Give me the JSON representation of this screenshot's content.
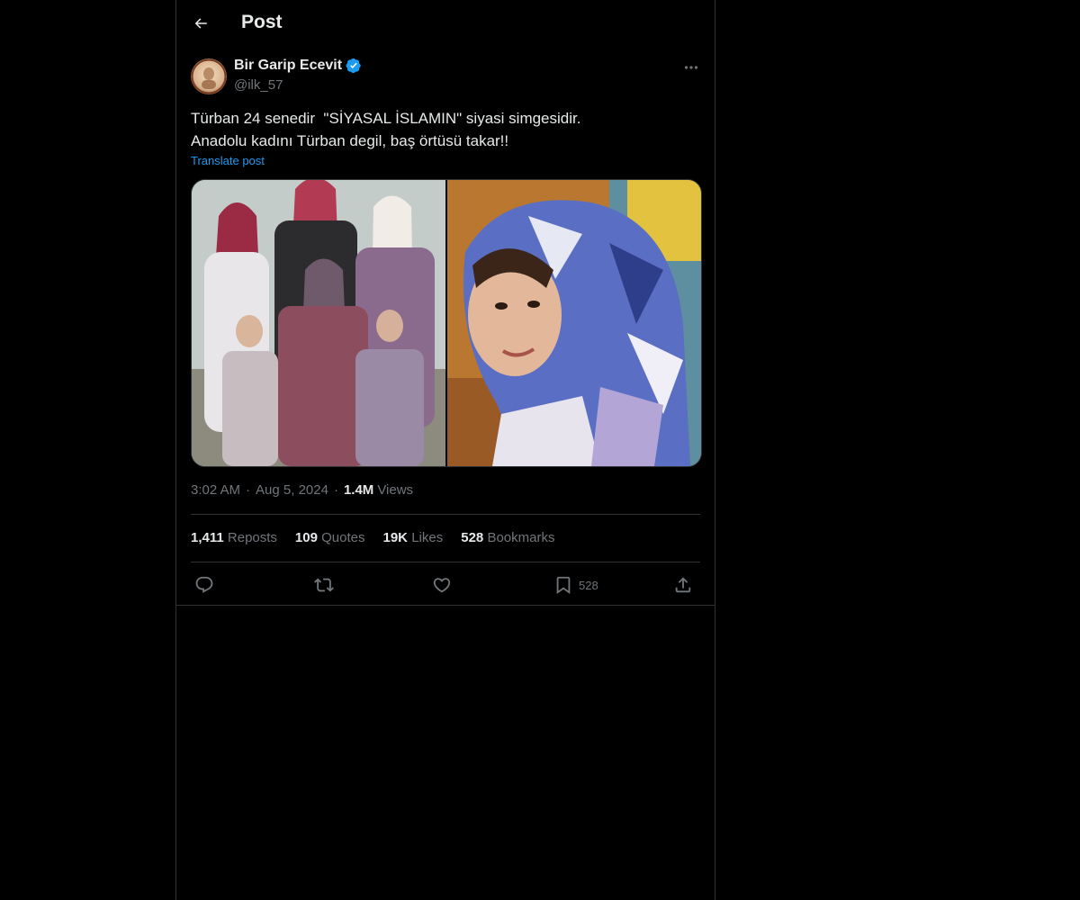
{
  "header": {
    "title": "Post"
  },
  "author": {
    "name": "Bir Garip Ecevit",
    "handle": "@ilk_57",
    "verified": true
  },
  "post": {
    "lines": [
      "Türban 24 senedir  \"SİYASAL İSLAMIN\" siyasi simgesidir.",
      "Anadolu kadını Türban degil, baş örtüsü takar!!"
    ],
    "translate_label": "Translate post"
  },
  "meta": {
    "time": "3:02 AM",
    "separator": "·",
    "date": "Aug 5, 2024",
    "views_count": "1.4M",
    "views_label": "Views"
  },
  "stats": {
    "reposts": {
      "count": "1,411",
      "label": "Reposts"
    },
    "quotes": {
      "count": "109",
      "label": "Quotes"
    },
    "likes": {
      "count": "19K",
      "label": "Likes"
    },
    "bookmarks": {
      "count": "528",
      "label": "Bookmarks"
    }
  },
  "actions": {
    "bookmark_count": "528"
  },
  "colors": {
    "background": "#000000",
    "text": "#e7e9ea",
    "muted": "#71767b",
    "link": "#1d9bf0",
    "verified": "#1d9bf0",
    "border": "#2f3336"
  },
  "icons": {
    "back": "arrow-left-icon",
    "verified": "verified-badge-icon",
    "more": "more-horizontal-icon",
    "reply": "reply-icon",
    "repost": "repost-icon",
    "like": "heart-icon",
    "bookmark": "bookmark-icon",
    "share": "share-icon"
  }
}
